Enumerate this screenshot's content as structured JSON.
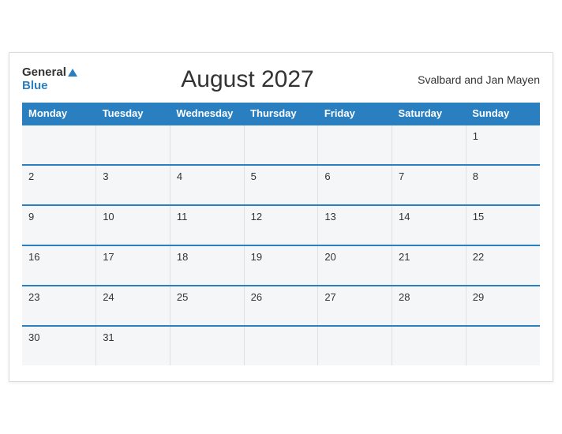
{
  "header": {
    "logo_general": "General",
    "logo_blue": "Blue",
    "title": "August 2027",
    "region": "Svalbard and Jan Mayen"
  },
  "weekdays": [
    "Monday",
    "Tuesday",
    "Wednesday",
    "Thursday",
    "Friday",
    "Saturday",
    "Sunday"
  ],
  "weeks": [
    [
      "",
      "",
      "",
      "",
      "",
      "",
      "1"
    ],
    [
      "2",
      "3",
      "4",
      "5",
      "6",
      "7",
      "8"
    ],
    [
      "9",
      "10",
      "11",
      "12",
      "13",
      "14",
      "15"
    ],
    [
      "16",
      "17",
      "18",
      "19",
      "20",
      "21",
      "22"
    ],
    [
      "23",
      "24",
      "25",
      "26",
      "27",
      "28",
      "29"
    ],
    [
      "30",
      "31",
      "",
      "",
      "",
      "",
      ""
    ]
  ]
}
